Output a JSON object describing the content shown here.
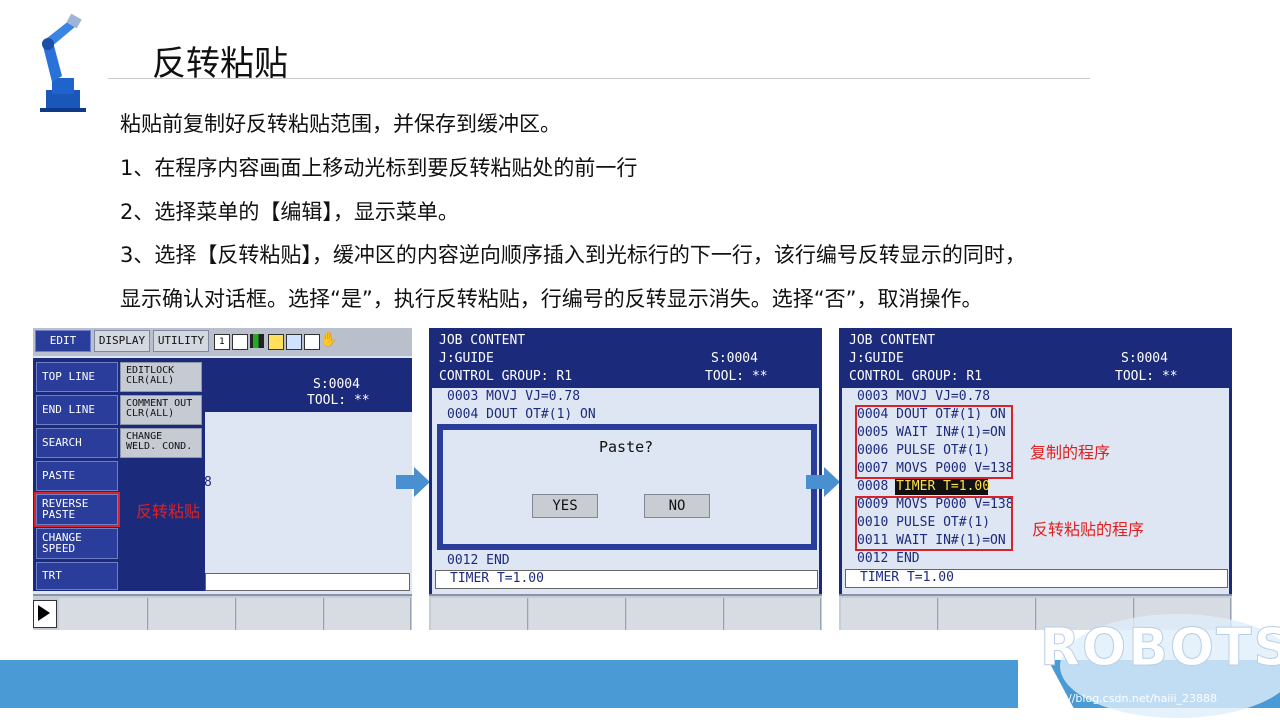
{
  "slide": {
    "title": "反转粘贴",
    "paragraphs": [
      "粘贴前复制好反转粘贴范围，并保存到缓冲区。",
      "1、在程序内容画面上移动光标到要反转粘贴处的前一行",
      "2、选择菜单的【编辑】，显示菜单。",
      "3、选择【反转粘贴】，缓冲区的内容逆向顺序插入到光标行的下一行，该行编号反转显示的同时，",
      "显示确认对话框。选择“是”，执行反转粘贴，行编号的反转显示消失。选择“否”，取消操作。"
    ],
    "watermark": "ROBOTS",
    "footer_url": "https://blog.csdn.net/haiii_23888"
  },
  "screen1": {
    "tabs": [
      "EDIT",
      "DISPLAY",
      "UTILITY"
    ],
    "menu_left": [
      "TOP LINE",
      "END LINE",
      "SEARCH",
      "PASTE",
      "REVERSE PASTE",
      "CHANGE SPEED",
      "TRT"
    ],
    "menu_right": [
      "EDITLOCK CLR(ALL)",
      "COMMENT OUT CLR(ALL)",
      "CHANGE WELD. COND."
    ],
    "status_s": "S:0004",
    "status_tool": "TOOL: **",
    "partial_digit": "8",
    "annotation": "反转粘贴",
    "play_icon": "play-icon"
  },
  "screen2": {
    "header1": "JOB CONTENT",
    "header2": "J:GUIDE",
    "header2_right": "S:0004",
    "header3": "CONTROL GROUP: R1",
    "header3_right": "TOOL: **",
    "line1": "0003 MOVJ VJ=0.78",
    "line2": "0004 DOUT OT#(1) ON",
    "dialog_text": "Paste?",
    "yes_label": "YES",
    "no_label": "NO",
    "line_end": "0012 END",
    "input_line": "TIMER T=1.00"
  },
  "screen3": {
    "header1": "JOB CONTENT",
    "header2": "J:GUIDE",
    "header2_right": "S:0004",
    "header3": "CONTROL GROUP: R1",
    "header3_right": "TOOL: **",
    "lines": [
      "0003 MOVJ VJ=0.78",
      "0004 DOUT OT#(1) ON",
      "0005 WAIT IN#(1)=ON",
      "0006 PULSE OT#(1)",
      "0007 MOVS P000 V=138",
      "0008 TIMER T=1.00",
      "0009 MOVS P000 V=138",
      "0010 PULSE OT#(1)",
      "0011 WAIT IN#(1)=ON",
      "0012 END"
    ],
    "input_line": "TIMER T=1.00",
    "annotation_copied": "复制的程序",
    "annotation_reversed": "反转粘贴的程序"
  },
  "colors": {
    "screen_bg": "#1c2a7c",
    "content_bg": "#dfe6f3",
    "accent_red": "#d9222a",
    "footer_blue": "#4a9ad6",
    "arrow_blue": "#4a8fd0"
  }
}
